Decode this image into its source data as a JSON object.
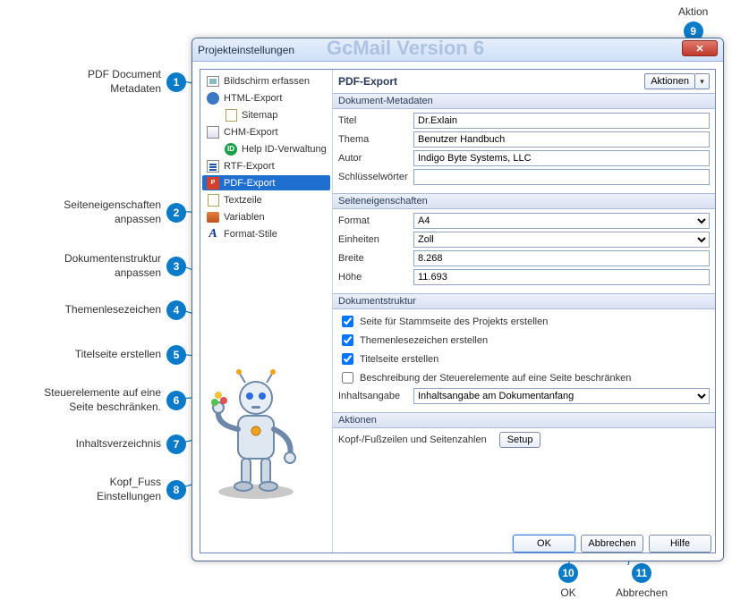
{
  "window": {
    "title": "Projekteinstellungen",
    "behind": "GcMail Version 6"
  },
  "tree": {
    "items": [
      {
        "label": "Bildschirm erfassen",
        "icon": "screen"
      },
      {
        "label": "HTML-Export",
        "icon": "globe"
      },
      {
        "label": "Sitemap",
        "icon": "page",
        "child": true
      },
      {
        "label": "CHM-Export",
        "icon": "chm"
      },
      {
        "label": "Help ID-Verwaltung",
        "icon": "help",
        "child": true
      },
      {
        "label": "RTF-Export",
        "icon": "rtf"
      },
      {
        "label": "PDF-Export",
        "icon": "pdf",
        "sel": true
      },
      {
        "label": "Textzeile",
        "icon": "page"
      },
      {
        "label": "Variablen",
        "icon": "pal"
      },
      {
        "label": "Format-Stile",
        "icon": "A"
      }
    ]
  },
  "header": {
    "title": "PDF-Export",
    "action": "Aktionen"
  },
  "metadata": {
    "head": "Dokument-Metadaten",
    "title_l": "Titel",
    "title_v": "Dr.Exlain",
    "theme_l": "Thema",
    "theme_v": "Benutzer Handbuch",
    "author_l": "Autor",
    "author_v": "Indigo Byte Systems, LLC",
    "keys_l": "Schlüsselwörter",
    "keys_v": ""
  },
  "page": {
    "head": "Seiteneigenschaften",
    "format_l": "Format",
    "format_v": "A4",
    "unit_l": "Einheiten",
    "unit_v": "Zoll",
    "width_l": "Breite",
    "width_v": "8.268",
    "height_l": "Höhe",
    "height_v": "11.693"
  },
  "struct": {
    "head": "Dokumentstruktur",
    "c1": "Seite für Stammseite des Projekts erstellen",
    "c2": "Themenlesezeichen erstellen",
    "c3": "Titelseite erstellen",
    "c4": "Beschreibung der Steuerelemente auf eine Seite beschränken",
    "toc_l": "Inhaltsangabe",
    "toc_v": "Inhaltsangabe am Dokumentanfang"
  },
  "actions": {
    "head": "Aktionen",
    "hf": "Kopf-/Fußzeilen und Seitenzahlen",
    "setup": "Setup"
  },
  "buttons": {
    "ok": "OK",
    "cancel": "Abbrechen",
    "help": "Hilfe"
  },
  "callouts": {
    "c1": "PDF Document\nMetadaten",
    "c2": "Seiteneigenschaften\nanpassen",
    "c3": "Dokumentenstruktur\nanpassen",
    "c4": "Themenlesezeichen",
    "c5": "Titelseite erstellen",
    "c6": "Steuerelemente auf eine\nSeite beschränken.",
    "c7": "Inhaltsverzeichnis",
    "c8": "Kopf_Fuss\nEinstellungen",
    "c9": "Aktion",
    "c10": "OK",
    "c11": "Abbrechen"
  }
}
